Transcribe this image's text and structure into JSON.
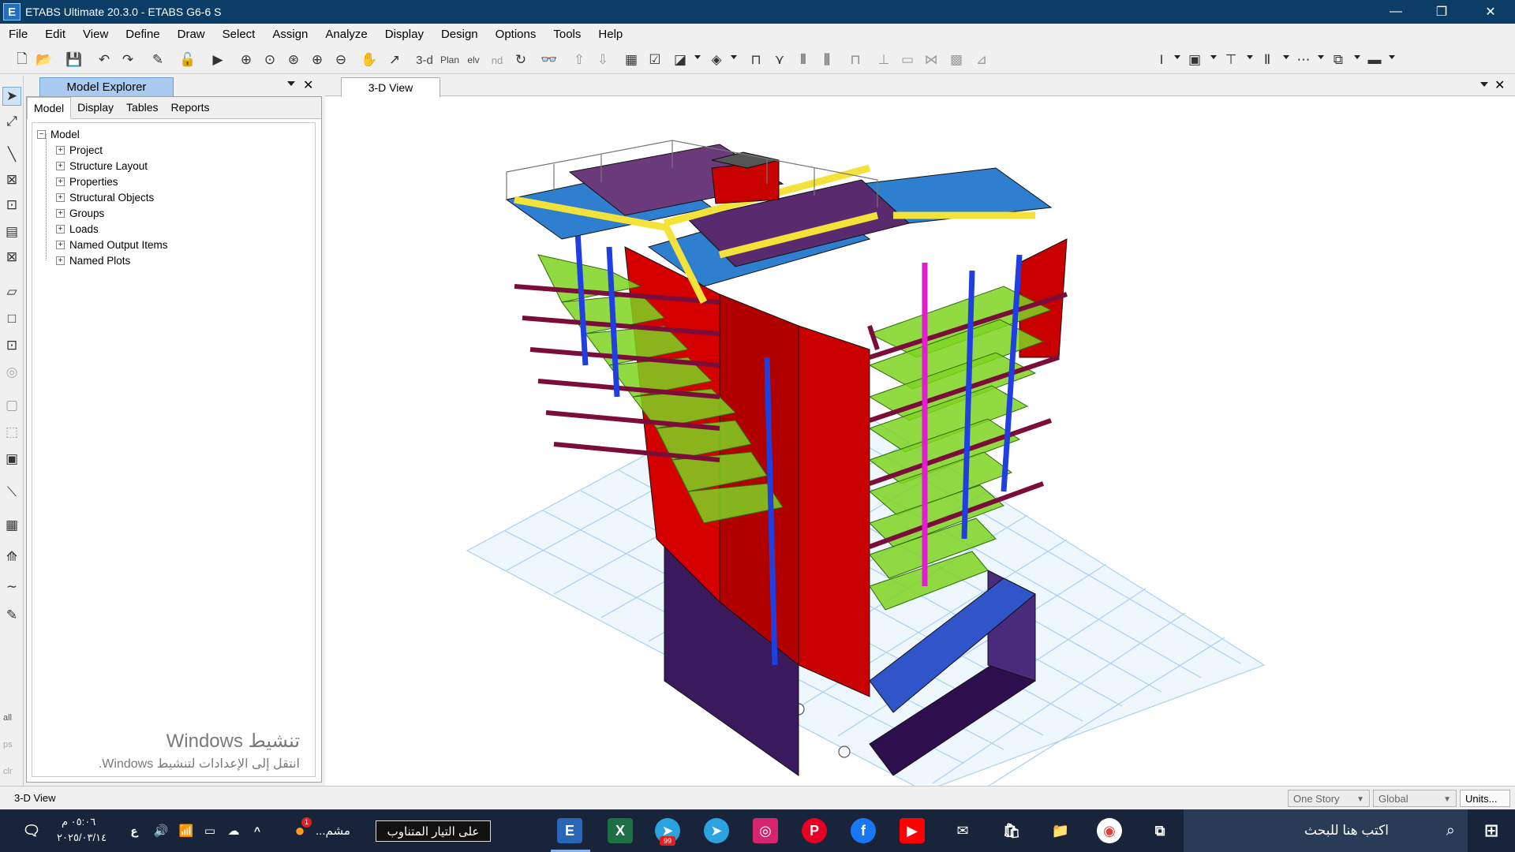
{
  "window": {
    "title": "ETABS Ultimate 20.3.0 - ETABS G6-6 S",
    "app_icon_letter": "E",
    "minimize": "—",
    "restore": "❐",
    "close": "✕"
  },
  "menu": [
    "File",
    "Edit",
    "View",
    "Define",
    "Draw",
    "Select",
    "Assign",
    "Analyze",
    "Display",
    "Design",
    "Options",
    "Tools",
    "Help"
  ],
  "toolbar": {
    "view_3d_label": "3-d",
    "plan_label": "Plan",
    "elev_label": "elv",
    "nd_label": "nd"
  },
  "explorer": {
    "title": "Model Explorer",
    "tabs": [
      "Model",
      "Display",
      "Tables",
      "Reports"
    ],
    "active_tab": "Model",
    "root": "Model",
    "items": [
      "Project",
      "Structure Layout",
      "Properties",
      "Structural Objects",
      "Groups",
      "Loads",
      "Named Output Items",
      "Named Plots"
    ],
    "expand_glyph": "+",
    "collapse_glyph": "−"
  },
  "lefttools_labels": {
    "all": "all",
    "ps": "ps",
    "clr": "clr"
  },
  "activation_watermark": {
    "line1": "تنشيط Windows",
    "line2": "انتقل إلى الإعدادات لتنشيط Windows."
  },
  "view": {
    "tab_label": "3-D View"
  },
  "status": {
    "left_text": "3-D View",
    "story_combo": "One Story",
    "coord_combo": "Global",
    "units_button": "Units..."
  },
  "colors": {
    "titlebar": "#0b3d66",
    "slab_green": "#7ed321",
    "wall_red": "#d40000",
    "deck_blue": "#2f7fd0",
    "beam_maroon": "#7a0d3a",
    "grid_blue": "#a9d0f5"
  },
  "taskbar": {
    "tooltip": "على التيار المتناوب",
    "running_app_label": "مشم...",
    "search_placeholder": "اكتب هنا للبحث",
    "time": "٠٥:٠٦ م",
    "date": "٢٠٢٥/٠٣/١٤",
    "lang": "ع",
    "telegram_badge": "99",
    "notif_badge": "1"
  }
}
